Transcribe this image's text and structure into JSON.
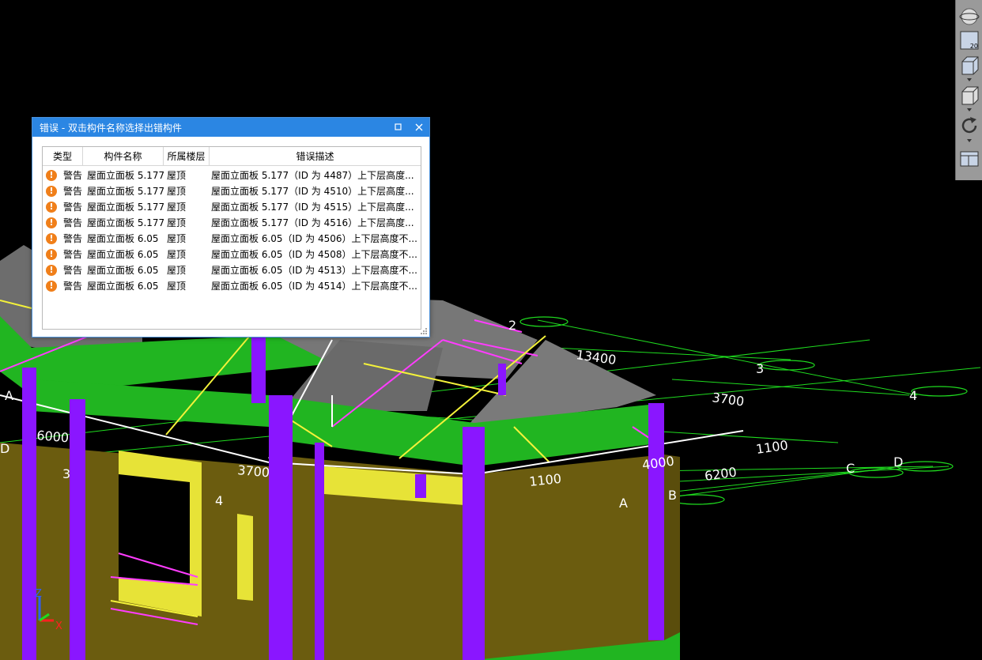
{
  "dialog": {
    "title": "错误 - 双击构件名称选择出错构件",
    "columns": [
      "类型",
      "构件名称",
      "所属楼层",
      "错误描述"
    ],
    "rows": [
      {
        "type": "警告",
        "name": "屋面立面板 5.177",
        "floor": "屋顶",
        "desc": "屋面立面板 5.177（ID 为 4487）上下层高度..."
      },
      {
        "type": "警告",
        "name": "屋面立面板 5.177",
        "floor": "屋顶",
        "desc": "屋面立面板 5.177（ID 为 4510）上下层高度..."
      },
      {
        "type": "警告",
        "name": "屋面立面板 5.177",
        "floor": "屋顶",
        "desc": "屋面立面板 5.177（ID 为 4515）上下层高度..."
      },
      {
        "type": "警告",
        "name": "屋面立面板 5.177",
        "floor": "屋顶",
        "desc": "屋面立面板 5.177（ID 为 4516）上下层高度..."
      },
      {
        "type": "警告",
        "name": "屋面立面板 6.05",
        "floor": "屋顶",
        "desc": "屋面立面板 6.05（ID 为 4506）上下层高度不..."
      },
      {
        "type": "警告",
        "name": "屋面立面板 6.05",
        "floor": "屋顶",
        "desc": "屋面立面板 6.05（ID 为 4508）上下层高度不..."
      },
      {
        "type": "警告",
        "name": "屋面立面板 6.05",
        "floor": "屋顶",
        "desc": "屋面立面板 6.05（ID 为 4513）上下层高度不..."
      },
      {
        "type": "警告",
        "name": "屋面立面板 6.05",
        "floor": "屋顶",
        "desc": "屋面立面板 6.05（ID 为 4514）上下层高度不..."
      }
    ]
  },
  "toolbar": {
    "layer_label": "20",
    "icons": [
      "orbit-icon",
      "2d-view-icon",
      "3d-view-icon",
      "box-view-icon",
      "rotate-icon",
      "layout-icon"
    ]
  },
  "viewport": {
    "dimensions": [
      "13400",
      "3700",
      "6000",
      "3700",
      "4000",
      "1100",
      "1100",
      "6200"
    ],
    "axis_labels": [
      "3",
      "4",
      "A",
      "B",
      "C",
      "D",
      "3",
      "4",
      "A",
      "D",
      "2"
    ],
    "coord_labels": {
      "z": "Z",
      "x": "X"
    }
  },
  "colors": {
    "title_bar": "#2b86e3",
    "warning": "#f07f1a",
    "column": "#8a16ff",
    "wall": "#6b5c0f",
    "beam": "#21b521",
    "roof": "#7a7a7a"
  }
}
